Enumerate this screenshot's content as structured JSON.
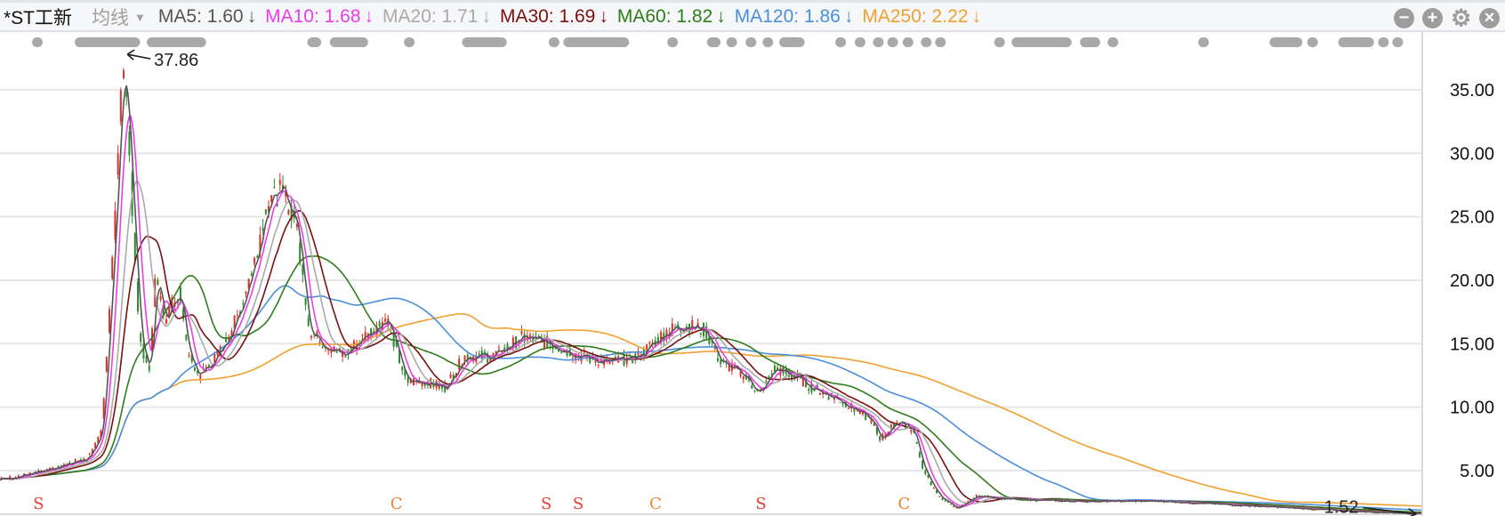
{
  "header": {
    "title": "*ST工新",
    "mode": "均线",
    "ma": [
      {
        "label": "MA5: 1.60",
        "arrow": "↓",
        "color": "#555555"
      },
      {
        "label": "MA10: 1.68",
        "arrow": "↓",
        "color": "#e83ee8"
      },
      {
        "label": "MA20: 1.71",
        "arrow": "↓",
        "color": "#aaaaaa"
      },
      {
        "label": "MA30: 1.69",
        "arrow": "↓",
        "color": "#7a1010"
      },
      {
        "label": "MA60: 1.82",
        "arrow": "↓",
        "color": "#2f7d1a"
      },
      {
        "label": "MA120: 1.86",
        "arrow": "↓",
        "color": "#4a8fdc"
      },
      {
        "label": "MA250: 2.22",
        "arrow": "↓",
        "color": "#f0a030"
      }
    ],
    "tools": [
      "zoom-out",
      "zoom-in",
      "settings",
      "close"
    ]
  },
  "chart_data": {
    "type": "line",
    "title": "*ST工新 price with moving averages",
    "ylim": [
      1.5,
      39.5
    ],
    "xlim": [
      0,
      1470
    ],
    "y_ticks": [
      "5.00",
      "10.00",
      "15.00",
      "20.00",
      "25.00",
      "30.00",
      "35.00"
    ],
    "y_tick_values": [
      5,
      10,
      15,
      20,
      25,
      30,
      35
    ],
    "grid": true,
    "close_keypoints": [
      [
        0,
        4.3
      ],
      [
        50,
        5
      ],
      [
        90,
        6
      ],
      [
        105,
        8
      ],
      [
        115,
        20
      ],
      [
        125,
        35
      ],
      [
        128,
        37.86
      ],
      [
        135,
        28
      ],
      [
        145,
        15
      ],
      [
        155,
        13
      ],
      [
        160,
        20
      ],
      [
        170,
        17
      ],
      [
        185,
        19
      ],
      [
        195,
        14
      ],
      [
        205,
        12.5
      ],
      [
        225,
        14
      ],
      [
        245,
        17
      ],
      [
        265,
        22
      ],
      [
        275,
        26
      ],
      [
        290,
        27
      ],
      [
        305,
        25
      ],
      [
        320,
        16
      ],
      [
        335,
        15
      ],
      [
        355,
        14
      ],
      [
        375,
        15.5
      ],
      [
        400,
        17
      ],
      [
        420,
        12
      ],
      [
        440,
        12
      ],
      [
        460,
        11.5
      ],
      [
        480,
        14
      ],
      [
        510,
        14
      ],
      [
        540,
        15.5
      ],
      [
        570,
        15
      ],
      [
        600,
        14
      ],
      [
        630,
        13.5
      ],
      [
        660,
        14
      ],
      [
        690,
        16
      ],
      [
        710,
        16.5
      ],
      [
        730,
        16
      ],
      [
        745,
        13.5
      ],
      [
        770,
        12.5
      ],
      [
        785,
        11
      ],
      [
        800,
        13
      ],
      [
        820,
        12.5
      ],
      [
        840,
        11.5
      ],
      [
        870,
        10.5
      ],
      [
        900,
        9
      ],
      [
        910,
        7.5
      ],
      [
        930,
        9
      ],
      [
        945,
        8
      ],
      [
        955,
        5
      ],
      [
        970,
        3
      ],
      [
        990,
        2
      ],
      [
        1010,
        3
      ],
      [
        1040,
        2.8
      ],
      [
        1100,
        2.6
      ],
      [
        1200,
        2.6
      ],
      [
        1300,
        2.2
      ],
      [
        1400,
        1.8
      ],
      [
        1470,
        1.6
      ]
    ],
    "series": [
      {
        "name": "MA5",
        "window": 5,
        "color": "#555555"
      },
      {
        "name": "MA10",
        "window": 10,
        "color": "#e83ee8"
      },
      {
        "name": "MA20",
        "window": 20,
        "color": "#aaaaaa"
      },
      {
        "name": "MA30",
        "window": 30,
        "color": "#7a1010"
      },
      {
        "name": "MA60",
        "window": 60,
        "color": "#2f7d1a"
      },
      {
        "name": "MA120",
        "window": 120,
        "color": "#4a8fdc"
      },
      {
        "name": "MA250",
        "window": 250,
        "color": "#f0a030"
      }
    ],
    "annotations": [
      {
        "text": "37.86",
        "x": 128,
        "y": 37.86,
        "kind": "max"
      },
      {
        "text": "1.52",
        "x": 1465,
        "y": 1.52,
        "kind": "min"
      }
    ],
    "markers": [
      {
        "text": "S",
        "x": 40,
        "color": "#e04030"
      },
      {
        "text": "C",
        "x": 410,
        "color": "#f08030"
      },
      {
        "text": "S",
        "x": 565,
        "color": "#e04030"
      },
      {
        "text": "S",
        "x": 598,
        "color": "#e04030"
      },
      {
        "text": "C",
        "x": 678,
        "color": "#f08030"
      },
      {
        "text": "S",
        "x": 787,
        "color": "#e04030"
      },
      {
        "text": "C",
        "x": 935,
        "color": "#f08030"
      }
    ]
  }
}
